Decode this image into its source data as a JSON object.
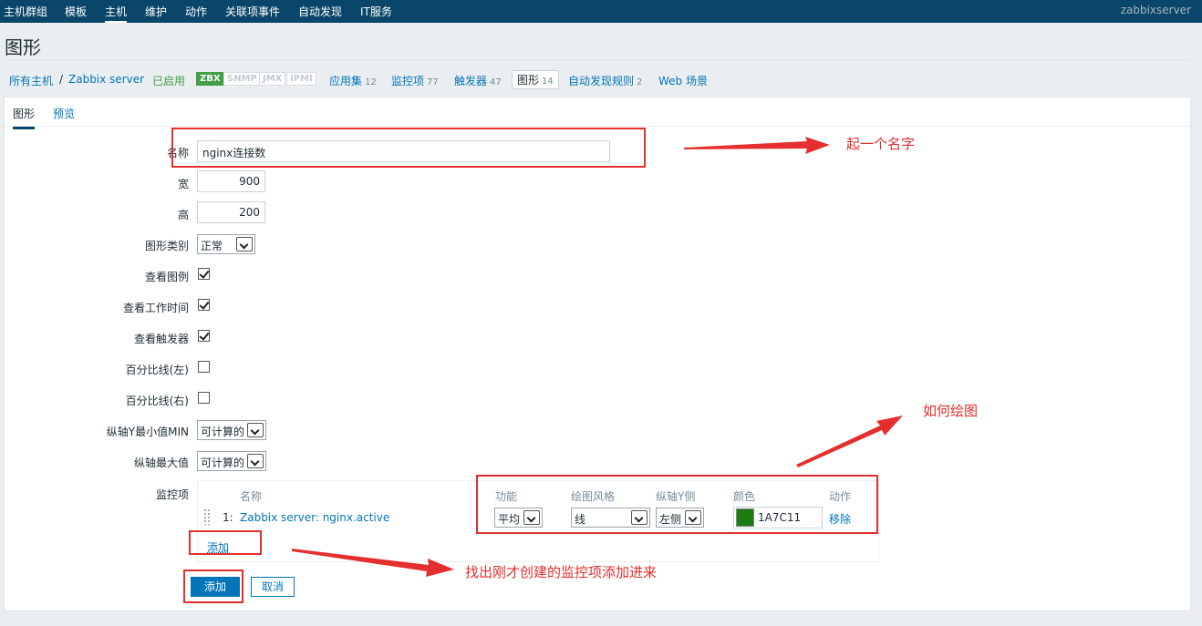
{
  "topnav": {
    "items": [
      "主机群组",
      "模板",
      "主机",
      "维护",
      "动作",
      "关联项事件",
      "自动发现",
      "IT服务"
    ],
    "active": "主机",
    "user": "zabbixserver"
  },
  "page_title": "图形",
  "hostnav": {
    "all_hosts": "所有主机",
    "separator": "/",
    "host": "Zabbix server",
    "status": "已启用",
    "availability": [
      "ZBX",
      "SNMP",
      "JMX",
      "IPMI"
    ],
    "links": [
      {
        "label": "应用集",
        "count": "12"
      },
      {
        "label": "监控项",
        "count": "77"
      },
      {
        "label": "触发器",
        "count": "47"
      },
      {
        "label": "图形",
        "count": "14"
      },
      {
        "label": "自动发现规则",
        "count": "2"
      },
      {
        "label": "Web 场景",
        "count": ""
      }
    ]
  },
  "tabs": [
    "图形",
    "预览"
  ],
  "form": {
    "name_label": "名称",
    "name_value": "nginx连接数",
    "width_label": "宽",
    "width_value": "900",
    "height_label": "高",
    "height_value": "200",
    "graph_type_label": "图形类别",
    "graph_type_value": "正常",
    "show_legend_label": "查看图例",
    "show_legend": true,
    "show_working_time_label": "查看工作时间",
    "show_working_time": true,
    "show_triggers_label": "查看触发器",
    "show_triggers": true,
    "percentile_left_label": "百分比线(左)",
    "percentile_left": false,
    "percentile_right_label": "百分比线(右)",
    "percentile_right": false,
    "ymin_label": "纵轴Y最小值MIN",
    "ymin_value": "可计算的",
    "ymax_label": "纵轴最大值",
    "ymax_value": "可计算的",
    "items_label": "监控项"
  },
  "items_table": {
    "headers": [
      "名称",
      "功能",
      "绘图风格",
      "纵轴Y侧",
      "颜色",
      "动作"
    ],
    "rows": [
      {
        "index": "1:",
        "name": "Zabbix server: nginx.active",
        "function": "平均",
        "draw_style": "线",
        "y_side": "左侧",
        "color": "1A7C11",
        "action": "移除"
      }
    ],
    "add_link": "添加"
  },
  "buttons": {
    "add": "添加",
    "cancel": "取消"
  },
  "annotations": {
    "name_note": "起一个名字",
    "draw_note": "如何绘图",
    "item_note": "找出刚才创建的监控项添加进来"
  },
  "colors": {
    "nav": "#0a466a",
    "link": "#0275b8",
    "annotation": "#e52e2e",
    "item_color": "#1a7c11"
  }
}
